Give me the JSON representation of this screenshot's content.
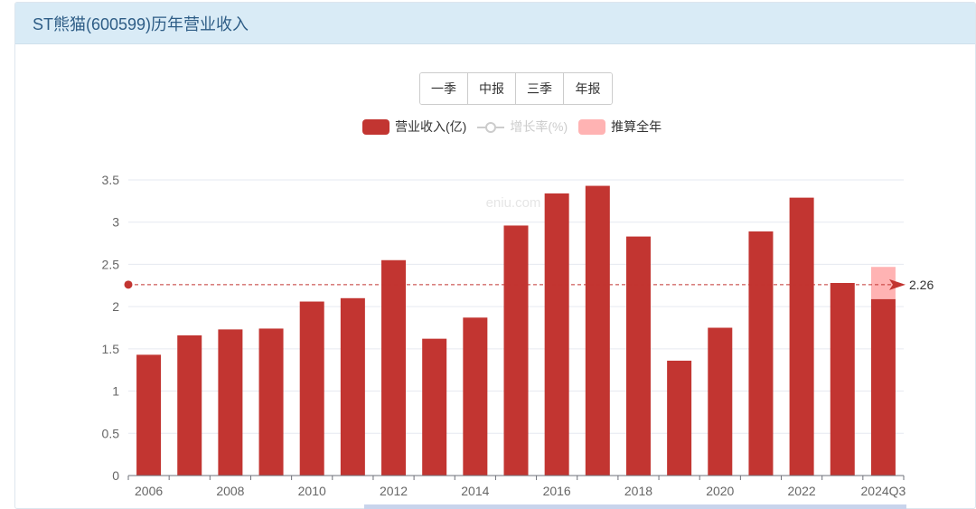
{
  "header": {
    "title": "ST熊猫(600599)历年营业收入"
  },
  "period_buttons": [
    {
      "label": "一季"
    },
    {
      "label": "中报"
    },
    {
      "label": "三季"
    },
    {
      "label": "年报"
    }
  ],
  "legend": [
    {
      "label": "营业收入(亿)",
      "color": "#c23531",
      "kind": "bar",
      "active": true
    },
    {
      "label": "增长率(%)",
      "color": "#cccccc",
      "kind": "line",
      "active": false
    },
    {
      "label": "推算全年",
      "color": "#ffb3b3",
      "kind": "bar",
      "active": true
    }
  ],
  "watermark": "eniu.com",
  "chart_data": {
    "type": "bar",
    "categories": [
      "2006",
      "2007",
      "2008",
      "2009",
      "2010",
      "2011",
      "2012",
      "2013",
      "2014",
      "2015",
      "2016",
      "2017",
      "2018",
      "2019",
      "2020",
      "2021",
      "2022",
      "2023",
      "2024Q3"
    ],
    "x_tick_labels": [
      "2006",
      "2008",
      "2010",
      "2012",
      "2014",
      "2016",
      "2018",
      "2020",
      "2022",
      "2024Q3"
    ],
    "series": [
      {
        "name": "营业收入(亿)",
        "color": "#c23531",
        "values": [
          1.43,
          1.66,
          1.73,
          1.74,
          2.06,
          2.1,
          2.55,
          1.62,
          1.87,
          2.96,
          3.34,
          3.43,
          2.83,
          1.36,
          1.75,
          2.89,
          3.29,
          2.28,
          2.09
        ]
      },
      {
        "name": "推算全年",
        "color": "#ffb3b3",
        "values": [
          null,
          null,
          null,
          null,
          null,
          null,
          null,
          null,
          null,
          null,
          null,
          null,
          null,
          null,
          null,
          null,
          null,
          null,
          2.47
        ]
      }
    ],
    "mark_line": {
      "value": 2.26,
      "label": "2.26",
      "color": "#c23531"
    },
    "ylim": [
      0,
      3.5
    ],
    "y_ticks": [
      0,
      0.5,
      1,
      1.5,
      2,
      2.5,
      3,
      3.5
    ],
    "y_tick_labels": [
      "0",
      "0.5",
      "1",
      "1.5",
      "2",
      "2.5",
      "3",
      "3.5"
    ],
    "grid": true
  }
}
